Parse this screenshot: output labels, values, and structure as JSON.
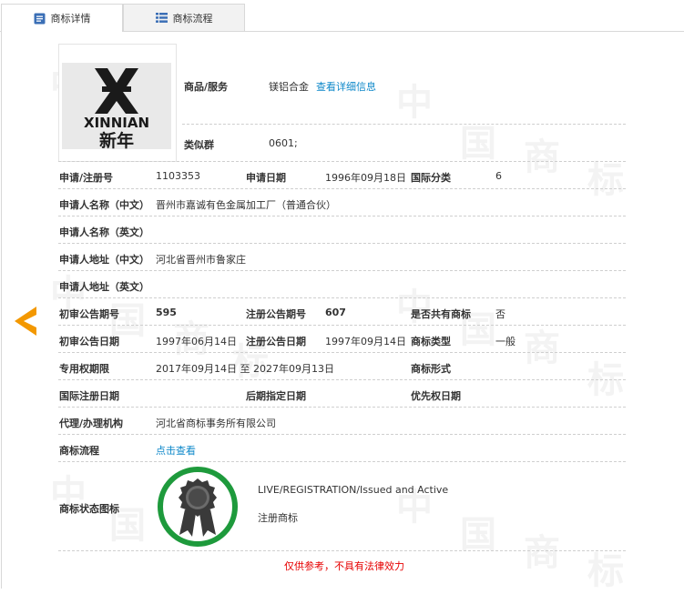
{
  "tabs": [
    {
      "label": "商标详情",
      "icon": "document-icon"
    },
    {
      "label": "商标流程",
      "icon": "list-icon"
    }
  ],
  "logo": {
    "text_en": "XINNIAN",
    "text_cn": "新年"
  },
  "goods_services": {
    "label": "商品/服务",
    "value": "镁铝合金",
    "link": "查看详细信息"
  },
  "similar_group": {
    "label": "类似群",
    "value": "0601;"
  },
  "fields": {
    "reg_no": {
      "label": "申请/注册号",
      "value": "1103353"
    },
    "app_date": {
      "label": "申请日期",
      "value": "1996年09月18日"
    },
    "intl_class": {
      "label": "国际分类",
      "value": "6"
    },
    "applicant_cn": {
      "label": "申请人名称（中文）",
      "value": "晋州市嘉诚有色金属加工厂（普通合伙）"
    },
    "applicant_en": {
      "label": "申请人名称（英文）",
      "value": ""
    },
    "address_cn": {
      "label": "申请人地址（中文）",
      "value": "河北省晋州市鲁家庄"
    },
    "address_en": {
      "label": "申请人地址（英文）",
      "value": ""
    },
    "prelim_issue": {
      "label": "初审公告期号",
      "value": "595"
    },
    "reg_issue": {
      "label": "注册公告期号",
      "value": "607"
    },
    "shared": {
      "label": "是否共有商标",
      "value": "否"
    },
    "prelim_date": {
      "label": "初审公告日期",
      "value": "1997年06月14日"
    },
    "reg_date": {
      "label": "注册公告日期",
      "value": "1997年09月14日"
    },
    "tm_type": {
      "label": "商标类型",
      "value": "一般"
    },
    "exclusive": {
      "label": "专用权期限",
      "value": "2017年09月14日 至 2027年09月13日"
    },
    "tm_form": {
      "label": "商标形式",
      "value": ""
    },
    "intl_reg_date": {
      "label": "国际注册日期",
      "value": ""
    },
    "later_date": {
      "label": "后期指定日期",
      "value": ""
    },
    "priority_date": {
      "label": "优先权日期",
      "value": ""
    },
    "agent": {
      "label": "代理/办理机构",
      "value": "河北省商标事务所有限公司"
    },
    "process": {
      "label": "商标流程",
      "link": "点击查看"
    },
    "status": {
      "label": "商标状态图标",
      "status_en": "LIVE/REGISTRATION/Issued and Active",
      "status_cn": "注册商标"
    }
  },
  "disclaimer": "仅供参考，不具有法律效力",
  "colors": {
    "link": "#0e88c9",
    "arrow": "#f39800",
    "badge_ring": "#1e9a3c",
    "disclaimer": "#e60000"
  }
}
